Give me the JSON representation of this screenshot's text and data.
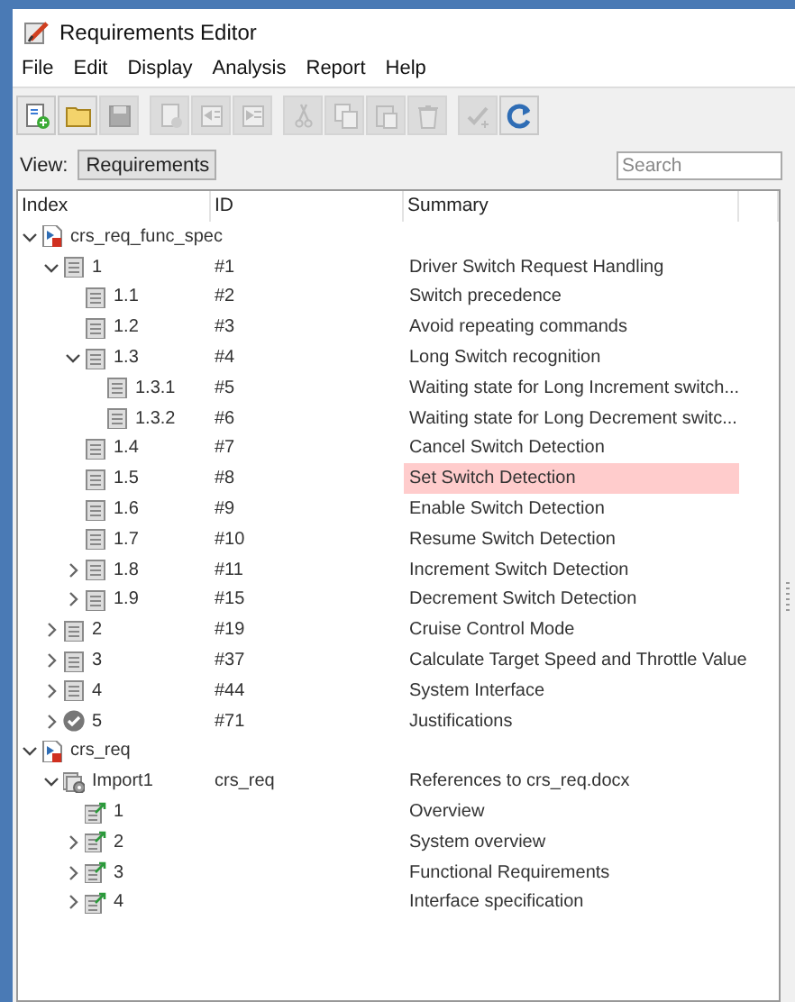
{
  "window": {
    "title": "Requirements Editor"
  },
  "menu": [
    "File",
    "Edit",
    "Display",
    "Analysis",
    "Report",
    "Help"
  ],
  "toolbar": [
    {
      "kind": "new",
      "disabled": false
    },
    {
      "kind": "open",
      "disabled": false
    },
    {
      "kind": "save",
      "disabled": true
    },
    {
      "kind": "add",
      "disabled": true
    },
    {
      "kind": "promote",
      "disabled": true
    },
    {
      "kind": "demote",
      "disabled": true
    },
    {
      "kind": "cut",
      "disabled": true
    },
    {
      "kind": "copy",
      "disabled": true
    },
    {
      "kind": "paste",
      "disabled": true
    },
    {
      "kind": "delete",
      "disabled": true
    },
    {
      "kind": "justify",
      "disabled": true
    },
    {
      "kind": "refresh",
      "disabled": false
    }
  ],
  "view": {
    "label": "View:",
    "value": "Requirements"
  },
  "search": {
    "placeholder": "Search"
  },
  "table": {
    "columns": [
      "Index",
      "ID",
      "Summary"
    ],
    "rows": [
      {
        "kind": "file",
        "index": "crs_req_func_spec",
        "expandable": true,
        "expanded": true,
        "selected": false,
        "children": [
          {
            "kind": "req",
            "index": "1",
            "id": "#1",
            "summary": "Driver Switch Request Handling",
            "expandable": true,
            "expanded": true,
            "selected": false,
            "children": [
              {
                "kind": "req",
                "index": "1.1",
                "id": "#2",
                "summary": "Switch precedence",
                "expandable": false,
                "selected": false
              },
              {
                "kind": "req",
                "index": "1.2",
                "id": "#3",
                "summary": "Avoid repeating commands",
                "expandable": false,
                "selected": false
              },
              {
                "kind": "req",
                "index": "1.3",
                "id": "#4",
                "summary": "Long Switch recognition",
                "expandable": true,
                "expanded": true,
                "selected": false,
                "children": [
                  {
                    "kind": "req",
                    "index": "1.3.1",
                    "id": "#5",
                    "summary": "Waiting state for Long Increment switch...",
                    "expandable": false,
                    "selected": false
                  },
                  {
                    "kind": "req",
                    "index": "1.3.2",
                    "id": "#6",
                    "summary": "Waiting state for Long Decrement switc...",
                    "expandable": false,
                    "selected": false
                  }
                ]
              },
              {
                "kind": "req",
                "index": "1.4",
                "id": "#7",
                "summary": "Cancel Switch Detection",
                "expandable": false,
                "selected": false
              },
              {
                "kind": "req",
                "index": "1.5",
                "id": "#8",
                "summary": "Set Switch Detection",
                "expandable": false,
                "selected": true
              },
              {
                "kind": "req",
                "index": "1.6",
                "id": "#9",
                "summary": "Enable Switch Detection",
                "expandable": false,
                "selected": false
              },
              {
                "kind": "req",
                "index": "1.7",
                "id": "#10",
                "summary": "Resume Switch Detection",
                "expandable": false,
                "selected": false
              },
              {
                "kind": "req",
                "index": "1.8",
                "id": "#11",
                "summary": "Increment Switch Detection",
                "expandable": true,
                "expanded": false,
                "selected": false
              },
              {
                "kind": "req",
                "index": "1.9",
                "id": "#15",
                "summary": "Decrement Switch Detection",
                "expandable": true,
                "expanded": false,
                "selected": false
              }
            ]
          },
          {
            "kind": "req",
            "index": "2",
            "id": "#19",
            "summary": "Cruise Control Mode",
            "expandable": true,
            "expanded": false,
            "selected": false
          },
          {
            "kind": "req",
            "index": "3",
            "id": "#37",
            "summary": "Calculate Target Speed and Throttle Value",
            "expandable": true,
            "expanded": false,
            "selected": false
          },
          {
            "kind": "req",
            "index": "4",
            "id": "#44",
            "summary": "System Interface",
            "expandable": true,
            "expanded": false,
            "selected": false
          },
          {
            "kind": "justification",
            "index": "5",
            "id": "#71",
            "summary": "Justifications",
            "expandable": true,
            "expanded": false,
            "selected": false
          }
        ]
      },
      {
        "kind": "file",
        "index": "crs_req",
        "expandable": true,
        "expanded": true,
        "selected": false,
        "children": [
          {
            "kind": "import",
            "index": "Import1",
            "id": "crs_req",
            "summary": "References to crs_req.docx",
            "expandable": true,
            "expanded": true,
            "selected": false,
            "children": [
              {
                "kind": "ref",
                "index": "1",
                "summary": "Overview",
                "expandable": false,
                "selected": false
              },
              {
                "kind": "ref",
                "index": "2",
                "summary": "System overview",
                "expandable": true,
                "expanded": false,
                "selected": false
              },
              {
                "kind": "ref",
                "index": "3",
                "summary": "Functional Requirements",
                "expandable": true,
                "expanded": false,
                "selected": false
              },
              {
                "kind": "ref",
                "index": "4",
                "summary": "Interface specification",
                "expandable": true,
                "expanded": false,
                "selected": false
              }
            ]
          }
        ]
      }
    ]
  }
}
